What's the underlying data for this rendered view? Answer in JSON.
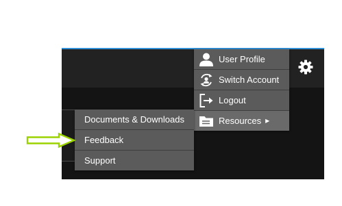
{
  "colors": {
    "accent": "#2f8fd6",
    "header": "#222222",
    "content": "#141414",
    "menu": "#5b5b5b",
    "menu_active": "#6a6a6a",
    "pointer_arrow": "#9bd300"
  },
  "header": {
    "settings_icon": "gear-icon"
  },
  "user_menu": {
    "items": [
      {
        "label": "User Profile",
        "icon": "user-icon"
      },
      {
        "label": "Switch Account",
        "icon": "switch-account-icon"
      },
      {
        "label": "Logout",
        "icon": "logout-icon"
      },
      {
        "label": "Resources",
        "icon": "folder-icon",
        "has_submenu": true,
        "caret": "▶"
      }
    ]
  },
  "resources_submenu": {
    "items": [
      {
        "label": "Documents & Downloads"
      },
      {
        "label": "Feedback"
      },
      {
        "label": "Support"
      }
    ]
  },
  "annotation": {
    "pointer": "arrow-pointing-to-feedback"
  }
}
